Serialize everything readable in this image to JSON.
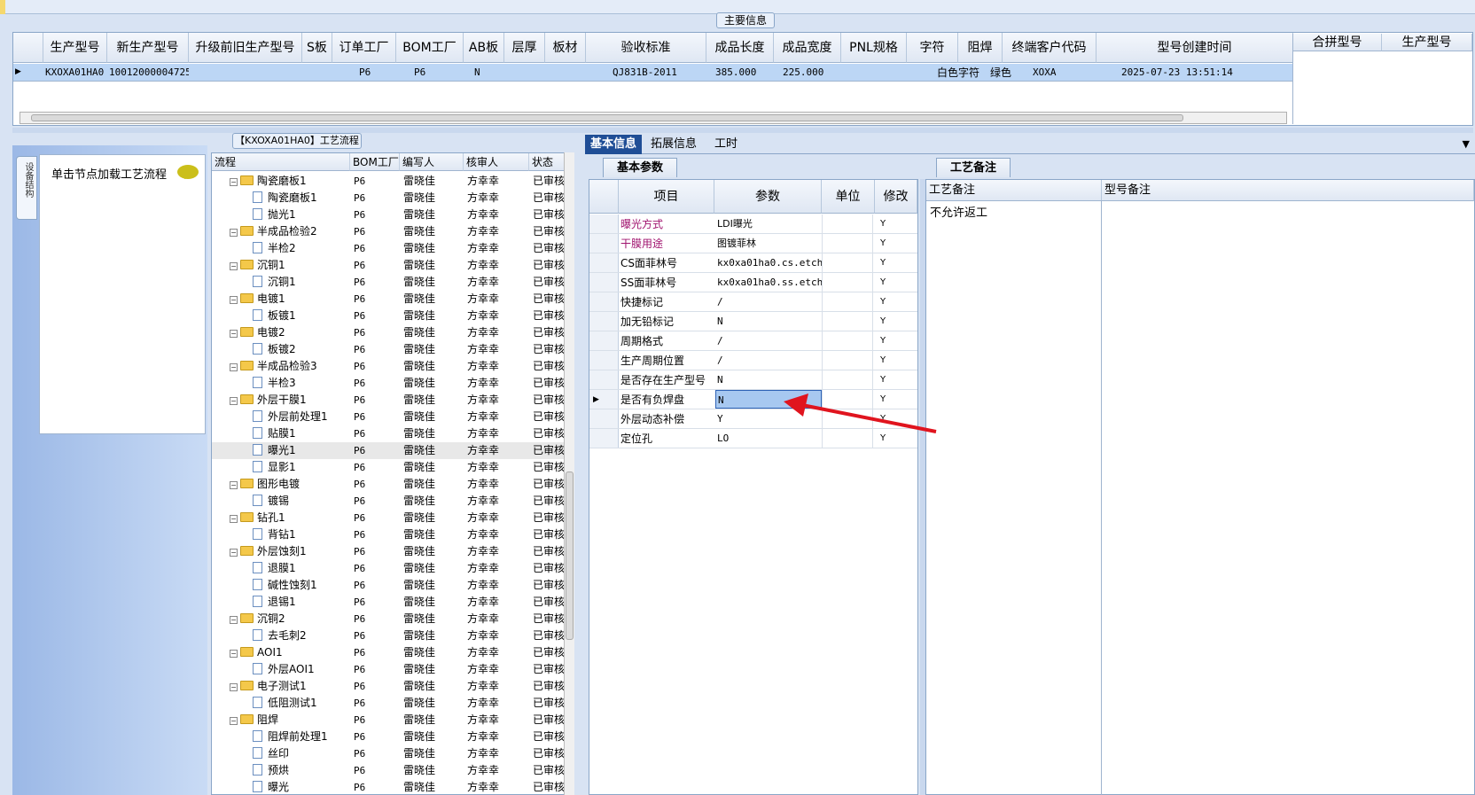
{
  "main": {
    "title": "主要信息",
    "columns": [
      "生产型号",
      "新生产型号",
      "升级前旧生产型号",
      "S板",
      "订单工厂",
      "BOM工厂",
      "AB板",
      "层厚",
      "板材",
      "验收标准",
      "成品长度",
      "成品宽度",
      "PNL规格",
      "字符",
      "阻焊",
      "终端客户代码",
      "型号创建时间"
    ],
    "row": [
      "KXOXA01HA0",
      "10012000004725",
      "",
      "",
      "P6",
      "P6",
      "N",
      "",
      "",
      "QJ831B-2011",
      "385.000",
      "225.000",
      "",
      "白色字符",
      "绿色",
      "XOXA",
      "2025-07-23 13:51:14"
    ],
    "merge_columns": [
      "合拼型号",
      "生产型号"
    ]
  },
  "sidebar": {
    "tab_label": "设备结构",
    "load_text": "单击节点加载工艺流程"
  },
  "flow": {
    "title": "【KXOXA01HA0】工艺流程",
    "columns": [
      "流程",
      "BOM工厂",
      "编写人",
      "核审人",
      "状态"
    ],
    "rows": [
      {
        "name": "陶瓷磨板1",
        "type": "folder",
        "bom": "P6",
        "writer": "雷晓佳",
        "reviewer": "方幸幸",
        "status": "已审核"
      },
      {
        "name": "陶瓷磨板1",
        "type": "doc",
        "bom": "P6",
        "writer": "雷晓佳",
        "reviewer": "方幸幸",
        "status": "已审核"
      },
      {
        "name": "抛光1",
        "type": "doc",
        "bom": "P6",
        "writer": "雷晓佳",
        "reviewer": "方幸幸",
        "status": "已审核"
      },
      {
        "name": "半成品检验2",
        "type": "folder",
        "bom": "P6",
        "writer": "雷晓佳",
        "reviewer": "方幸幸",
        "status": "已审核"
      },
      {
        "name": "半检2",
        "type": "doc",
        "bom": "P6",
        "writer": "雷晓佳",
        "reviewer": "方幸幸",
        "status": "已审核"
      },
      {
        "name": "沉铜1",
        "type": "folder",
        "bom": "P6",
        "writer": "雷晓佳",
        "reviewer": "方幸幸",
        "status": "已审核"
      },
      {
        "name": "沉铜1",
        "type": "doc",
        "bom": "P6",
        "writer": "雷晓佳",
        "reviewer": "方幸幸",
        "status": "已审核"
      },
      {
        "name": "电镀1",
        "type": "folder",
        "bom": "P6",
        "writer": "雷晓佳",
        "reviewer": "方幸幸",
        "status": "已审核"
      },
      {
        "name": "板镀1",
        "type": "doc",
        "bom": "P6",
        "writer": "雷晓佳",
        "reviewer": "方幸幸",
        "status": "已审核"
      },
      {
        "name": "电镀2",
        "type": "folder",
        "bom": "P6",
        "writer": "雷晓佳",
        "reviewer": "方幸幸",
        "status": "已审核"
      },
      {
        "name": "板镀2",
        "type": "doc",
        "bom": "P6",
        "writer": "雷晓佳",
        "reviewer": "方幸幸",
        "status": "已审核"
      },
      {
        "name": "半成品检验3",
        "type": "folder",
        "bom": "P6",
        "writer": "雷晓佳",
        "reviewer": "方幸幸",
        "status": "已审核"
      },
      {
        "name": "半检3",
        "type": "doc",
        "bom": "P6",
        "writer": "雷晓佳",
        "reviewer": "方幸幸",
        "status": "已审核"
      },
      {
        "name": "外层干膜1",
        "type": "folder",
        "bom": "P6",
        "writer": "雷晓佳",
        "reviewer": "方幸幸",
        "status": "已审核"
      },
      {
        "name": "外层前处理1",
        "type": "doc",
        "bom": "P6",
        "writer": "雷晓佳",
        "reviewer": "方幸幸",
        "status": "已审核"
      },
      {
        "name": "贴膜1",
        "type": "doc",
        "bom": "P6",
        "writer": "雷晓佳",
        "reviewer": "方幸幸",
        "status": "已审核"
      },
      {
        "name": "曝光1",
        "type": "doc",
        "bom": "P6",
        "writer": "雷晓佳",
        "reviewer": "方幸幸",
        "status": "已审核",
        "selected": true
      },
      {
        "name": "显影1",
        "type": "doc",
        "bom": "P6",
        "writer": "雷晓佳",
        "reviewer": "方幸幸",
        "status": "已审核"
      },
      {
        "name": "图形电镀",
        "type": "folder",
        "bom": "P6",
        "writer": "雷晓佳",
        "reviewer": "方幸幸",
        "status": "已审核"
      },
      {
        "name": "镀锡",
        "type": "doc",
        "bom": "P6",
        "writer": "雷晓佳",
        "reviewer": "方幸幸",
        "status": "已审核"
      },
      {
        "name": "钻孔1",
        "type": "folder",
        "bom": "P6",
        "writer": "雷晓佳",
        "reviewer": "方幸幸",
        "status": "已审核"
      },
      {
        "name": "背钻1",
        "type": "doc",
        "bom": "P6",
        "writer": "雷晓佳",
        "reviewer": "方幸幸",
        "status": "已审核"
      },
      {
        "name": "外层蚀刻1",
        "type": "folder",
        "bom": "P6",
        "writer": "雷晓佳",
        "reviewer": "方幸幸",
        "status": "已审核"
      },
      {
        "name": "退膜1",
        "type": "doc",
        "bom": "P6",
        "writer": "雷晓佳",
        "reviewer": "方幸幸",
        "status": "已审核"
      },
      {
        "name": "碱性蚀刻1",
        "type": "doc",
        "bom": "P6",
        "writer": "雷晓佳",
        "reviewer": "方幸幸",
        "status": "已审核"
      },
      {
        "name": "退锡1",
        "type": "doc",
        "bom": "P6",
        "writer": "雷晓佳",
        "reviewer": "方幸幸",
        "status": "已审核"
      },
      {
        "name": "沉铜2",
        "type": "folder",
        "bom": "P6",
        "writer": "雷晓佳",
        "reviewer": "方幸幸",
        "status": "已审核"
      },
      {
        "name": "去毛刺2",
        "type": "doc",
        "bom": "P6",
        "writer": "雷晓佳",
        "reviewer": "方幸幸",
        "status": "已审核"
      },
      {
        "name": "AOI1",
        "type": "folder",
        "bom": "P6",
        "writer": "雷晓佳",
        "reviewer": "方幸幸",
        "status": "已审核"
      },
      {
        "name": "外层AOI1",
        "type": "doc",
        "bom": "P6",
        "writer": "雷晓佳",
        "reviewer": "方幸幸",
        "status": "已审核"
      },
      {
        "name": "电子测试1",
        "type": "folder",
        "bom": "P6",
        "writer": "雷晓佳",
        "reviewer": "方幸幸",
        "status": "已审核"
      },
      {
        "name": "低阻测试1",
        "type": "doc",
        "bom": "P6",
        "writer": "雷晓佳",
        "reviewer": "方幸幸",
        "status": "已审核"
      },
      {
        "name": "阻焊",
        "type": "folder",
        "bom": "P6",
        "writer": "雷晓佳",
        "reviewer": "方幸幸",
        "status": "已审核"
      },
      {
        "name": "阻焊前处理1",
        "type": "doc",
        "bom": "P6",
        "writer": "雷晓佳",
        "reviewer": "方幸幸",
        "status": "已审核"
      },
      {
        "name": "丝印",
        "type": "doc",
        "bom": "P6",
        "writer": "雷晓佳",
        "reviewer": "方幸幸",
        "status": "已审核"
      },
      {
        "name": "预烘",
        "type": "doc",
        "bom": "P6",
        "writer": "雷晓佳",
        "reviewer": "方幸幸",
        "status": "已审核"
      },
      {
        "name": "曝光",
        "type": "doc",
        "bom": "P6",
        "writer": "雷晓佳",
        "reviewer": "方幸幸",
        "status": "已审核"
      }
    ]
  },
  "right_tabs": [
    "基本信息",
    "拓展信息",
    "工时"
  ],
  "params": {
    "subtab": "基本参数",
    "columns": [
      "项目",
      "参数",
      "单位",
      "修改"
    ],
    "rows": [
      {
        "item": "曝光方式",
        "value": "LDI曝光",
        "unit": "",
        "mod": "Y",
        "highlight": true
      },
      {
        "item": "干膜用途",
        "value": "图镀菲林",
        "unit": "",
        "mod": "Y",
        "highlight": true
      },
      {
        "item": "CS面菲林号",
        "value": "kx0xa01ha0.cs.etch",
        "unit": "",
        "mod": "Y"
      },
      {
        "item": "SS面菲林号",
        "value": "kx0xa01ha0.ss.etch",
        "unit": "",
        "mod": "Y"
      },
      {
        "item": "快捷标记",
        "value": "/",
        "unit": "",
        "mod": "Y"
      },
      {
        "item": "加无铅标记",
        "value": "N",
        "unit": "",
        "mod": "Y"
      },
      {
        "item": "周期格式",
        "value": "/",
        "unit": "",
        "mod": "Y"
      },
      {
        "item": "生产周期位置",
        "value": "/",
        "unit": "",
        "mod": "Y"
      },
      {
        "item": "是否存在生产型号",
        "value": "N",
        "unit": "",
        "mod": "Y"
      },
      {
        "item": "是否有负焊盘",
        "value": "N",
        "unit": "",
        "mod": "Y",
        "current": true
      },
      {
        "item": "外层动态补偿",
        "value": "Y",
        "unit": "",
        "mod": "Y"
      },
      {
        "item": "定位孔",
        "value": "LO",
        "unit": "",
        "mod": "Y"
      }
    ]
  },
  "notes": {
    "tab": "工艺备注",
    "columns": [
      "工艺备注",
      "型号备注"
    ],
    "process_note": "不允许返工"
  },
  "colors": {
    "accent": "#1f4e96",
    "selection": "#bcd6f5",
    "highlight_text": "#a0136f",
    "arrow": "#e0141e"
  }
}
